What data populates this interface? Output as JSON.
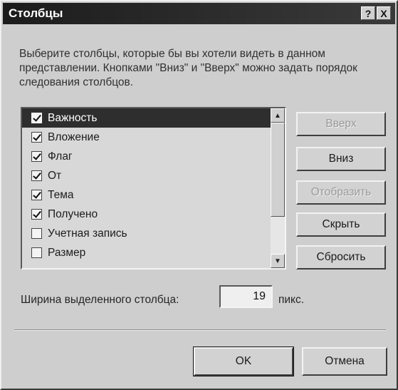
{
  "window": {
    "title": "Столбцы",
    "help_label": "?",
    "close_label": "X"
  },
  "description": "Выберите столбцы, которые бы вы хотели видеть в данном представлении. Кнопками \"Вниз\" и \"Вверх\" можно задать порядок следования столбцов.",
  "columns": [
    {
      "label": "Важность",
      "checked": true,
      "selected": true
    },
    {
      "label": "Вложение",
      "checked": true,
      "selected": false
    },
    {
      "label": "Флаг",
      "checked": true,
      "selected": false
    },
    {
      "label": "От",
      "checked": true,
      "selected": false
    },
    {
      "label": "Тема",
      "checked": true,
      "selected": false
    },
    {
      "label": "Получено",
      "checked": true,
      "selected": false
    },
    {
      "label": "Учетная запись",
      "checked": false,
      "selected": false
    },
    {
      "label": "Размер",
      "checked": false,
      "selected": false
    }
  ],
  "scrollbar": {
    "up_glyph": "▲",
    "down_glyph": "▼"
  },
  "buttons": {
    "up": "Вверх",
    "down": "Вниз",
    "show": "Отобразить",
    "hide": "Скрыть",
    "reset": "Сбросить",
    "ok": "OK",
    "cancel": "Отмена"
  },
  "width_field": {
    "label": "Ширина выделенного столбца:",
    "value": "19",
    "unit": "пикс."
  }
}
